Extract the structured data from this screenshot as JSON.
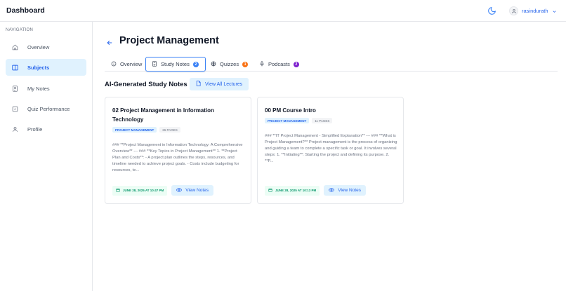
{
  "header": {
    "app_title": "Dashboard",
    "username": "rasindurath"
  },
  "sidebar": {
    "heading": "NAVIGATION",
    "items": [
      {
        "label": "Overview",
        "icon": "home-icon",
        "active": false
      },
      {
        "label": "Subjects",
        "icon": "book-icon",
        "active": true
      },
      {
        "label": "My Notes",
        "icon": "notes-icon",
        "active": false
      },
      {
        "label": "Quiz Performance",
        "icon": "quiz-icon",
        "active": false
      },
      {
        "label": "Profile",
        "icon": "user-icon",
        "active": false
      }
    ]
  },
  "page": {
    "title": "Project Management"
  },
  "tabs": [
    {
      "label": "Overview",
      "icon": "info-icon",
      "badge": null
    },
    {
      "label": "Study Notes",
      "icon": "document-icon",
      "badge": "2",
      "badge_color": "#3b82f6",
      "active": true
    },
    {
      "label": "Quizzes",
      "icon": "globe-icon",
      "badge": "1",
      "badge_color": "#f97316"
    },
    {
      "label": "Podcasts",
      "icon": "mic-icon",
      "badge": "2",
      "badge_color": "#7e22ce"
    }
  ],
  "section": {
    "title": "AI-Generated Study Notes",
    "view_all_label": "View All Lectures"
  },
  "cards": [
    {
      "title": "02 Project Management in Information Technology",
      "subject_tag": "PROJECT MANAGEMENT",
      "pages_tag": "26 PAGES",
      "excerpt": "### **Project Management in Information Technology: A Comprehensive Overview** --- ### **Key Topics in Project Management** 1. **Project Plan and Costs**: - A project plan outlines the steps, resources, and timeline needed to achieve project goals. - Costs include budgeting for resources, te...",
      "date": "JUNE 28, 2025 AT 10:47 PM",
      "view_label": "View Notes"
    },
    {
      "title": "00 PM Course Intro",
      "subject_tag": "PROJECT MANAGEMENT",
      "pages_tag": "11 PAGES",
      "excerpt": "### **IT Project Management - Simplified Explanation** --- ### **What is Project Management?** Project management is the process of organizing and guiding a team to complete a specific task or goal. It involves several steps: 1. **Initiating**: Starting the project and defining its purpose. 2. **P...",
      "date": "JUNE 28, 2025 AT 10:13 PM",
      "view_label": "View Notes"
    }
  ],
  "colors": {
    "accent": "#2563eb",
    "active_bg": "#e0f2fe",
    "date_green": "#059669"
  }
}
